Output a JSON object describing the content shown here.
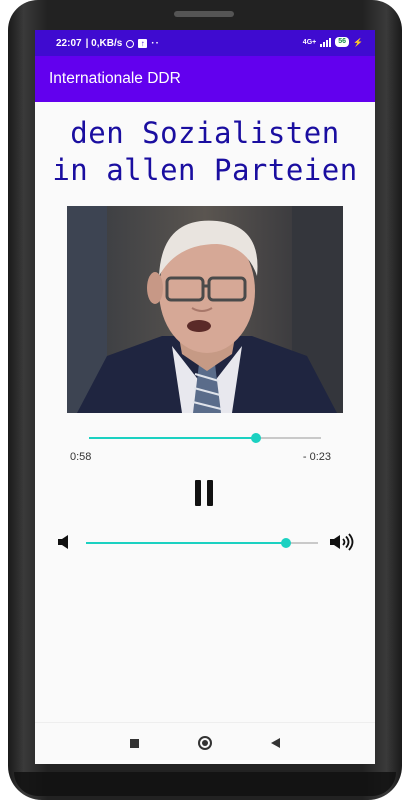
{
  "status_bar": {
    "time": "22:07",
    "speed": "| 0,KB/s",
    "network": "4G+",
    "battery": "56"
  },
  "app_bar": {
    "title": "Internationale DDR"
  },
  "lyrics": {
    "line1": "den Sozialisten",
    "line2": "in allen Parteien"
  },
  "player": {
    "elapsed": "0:58",
    "remaining": "- 0:23",
    "progress": 0.72,
    "volume": 0.86,
    "accent_color": "#1bd1c1",
    "track_color": "#c9c9c9",
    "play_state_icon": "pause-icon"
  },
  "theme": {
    "status_bar_color": "#3f0bd0",
    "app_bar_color": "#6200ee",
    "lyric_color": "#1a0ea0"
  },
  "nav": {
    "icons": [
      "recents-square-icon",
      "home-circle-icon",
      "back-triangle-icon"
    ]
  }
}
